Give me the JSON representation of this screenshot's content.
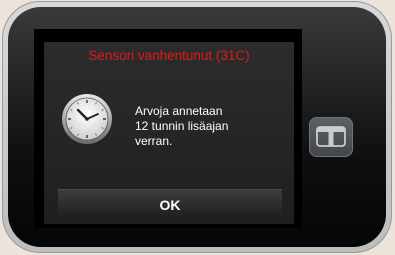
{
  "dialog": {
    "title": "Sensori vanhentunut (31C)",
    "message_lines": [
      "Arvoja annetaan",
      "12 tunnin lisäajan",
      "verran."
    ],
    "ok_label": "OK",
    "icon": "clock-icon"
  },
  "device": {
    "home_button_icon": "t-logo-icon"
  },
  "colors": {
    "title": "#e01a1a",
    "dialog_bg": "#2c2c2c",
    "background": "#ece3da"
  }
}
